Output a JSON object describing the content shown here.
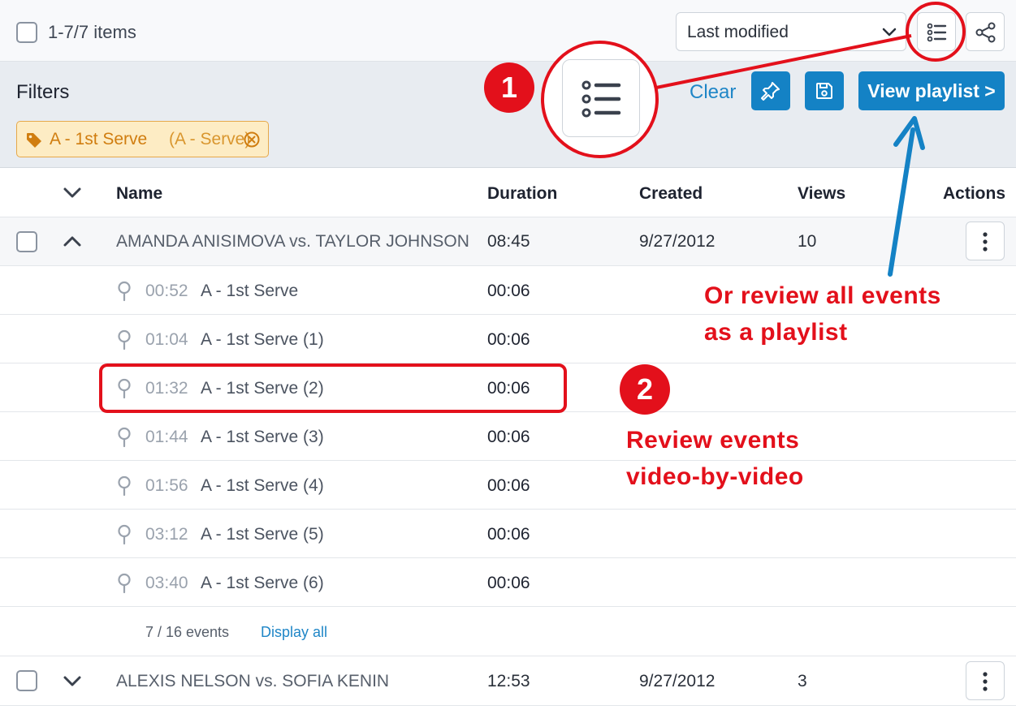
{
  "toolbar": {
    "items_count": "1-7/7 items",
    "sort_value": "Last modified"
  },
  "filters": {
    "label": "Filters",
    "chip_main": "A - 1st Serve",
    "chip_sub": "(A - Serve)",
    "clear_label": "Clear",
    "view_playlist_label": "View playlist >"
  },
  "table": {
    "headers": {
      "name": "Name",
      "duration": "Duration",
      "created": "Created",
      "views": "Views",
      "actions": "Actions"
    },
    "matches": [
      {
        "name": "AMANDA ANISIMOVA vs. TAYLOR JOHNSON",
        "duration": "08:45",
        "created": "9/27/2012",
        "views": "10"
      },
      {
        "name": "ALEXIS NELSON vs. SOFIA KENIN",
        "duration": "12:53",
        "created": "9/27/2012",
        "views": "3"
      }
    ],
    "events": [
      {
        "time": "00:52",
        "name": "A - 1st Serve",
        "duration": "00:06"
      },
      {
        "time": "01:04",
        "name": "A - 1st Serve (1)",
        "duration": "00:06"
      },
      {
        "time": "01:32",
        "name": "A - 1st Serve (2)",
        "duration": "00:06"
      },
      {
        "time": "01:44",
        "name": "A - 1st Serve (3)",
        "duration": "00:06"
      },
      {
        "time": "01:56",
        "name": "A - 1st Serve (4)",
        "duration": "00:06"
      },
      {
        "time": "03:12",
        "name": "A - 1st Serve (5)",
        "duration": "00:06"
      },
      {
        "time": "03:40",
        "name": "A - 1st Serve (6)",
        "duration": "00:06"
      }
    ],
    "events_count": "7 / 16",
    "events_word": "events",
    "display_all": "Display all"
  },
  "annotations": {
    "badge1": "1",
    "badge2": "2",
    "note_playlist_line1": "Or review all events",
    "note_playlist_line2": "as a playlist",
    "note_video_line1": "Review events",
    "note_video_line2": "video-by-video",
    "color": "#e3101b",
    "arrow_color": "#1482c5"
  },
  "colors": {
    "accent": "#1482c5",
    "chip_bg": "#fdecc4",
    "chip_text": "#d07d10"
  }
}
